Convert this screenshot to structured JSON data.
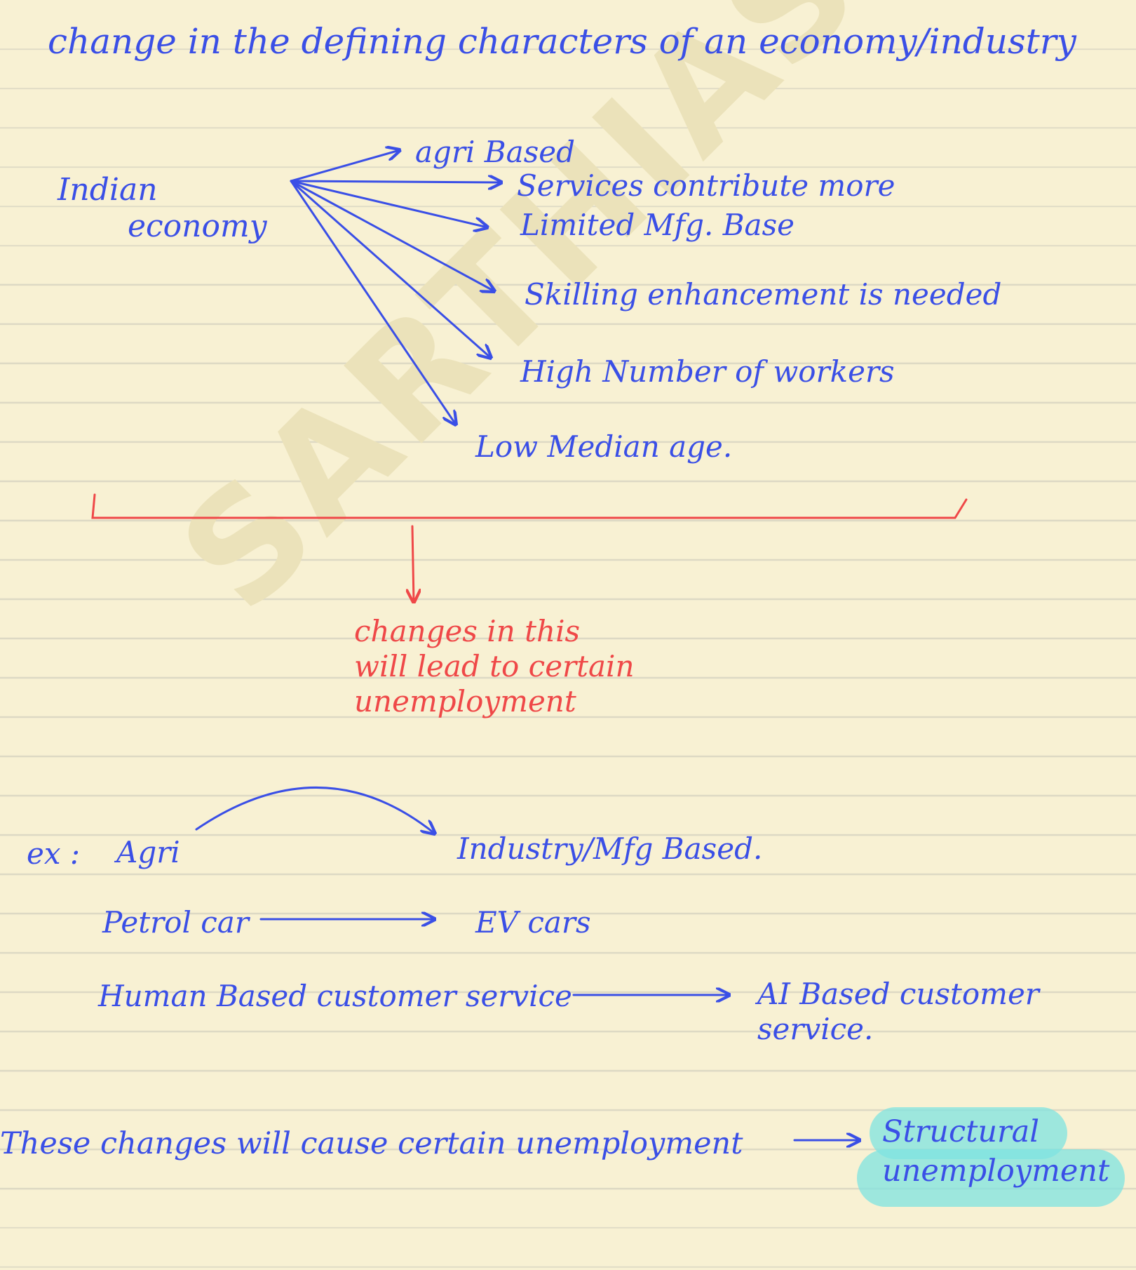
{
  "title": "change in the defining characters of an economy/industry",
  "mindmap": {
    "root_line1": "Indian",
    "root_line2": "economy",
    "branches": [
      "agri Based",
      "Services contribute more",
      "Limited Mfg. Base",
      "Skilling enhancement is needed",
      "High Number of workers",
      "Low Median age."
    ]
  },
  "note": {
    "line1": "changes in this",
    "line2": "will lead to certain",
    "line3": "unemployment"
  },
  "examples": {
    "label": "ex :",
    "pairs": [
      {
        "from": "Agri",
        "to": "Industry/Mfg Based."
      },
      {
        "from": "Petrol car",
        "to": "EV cars"
      },
      {
        "from": "Human Based customer service",
        "to_line1": "AI Based customer",
        "to_line2": "service."
      }
    ]
  },
  "conclusion": {
    "text": "These changes will cause certain unemployment",
    "result_line1": "Structural",
    "result_line2": "unemployment"
  },
  "colors": {
    "ink": "#3a4fe6",
    "red": "#ef4848",
    "paper": "#f8f1d3",
    "highlight": "#7fe3e0"
  },
  "watermark": "SARTHIAS"
}
